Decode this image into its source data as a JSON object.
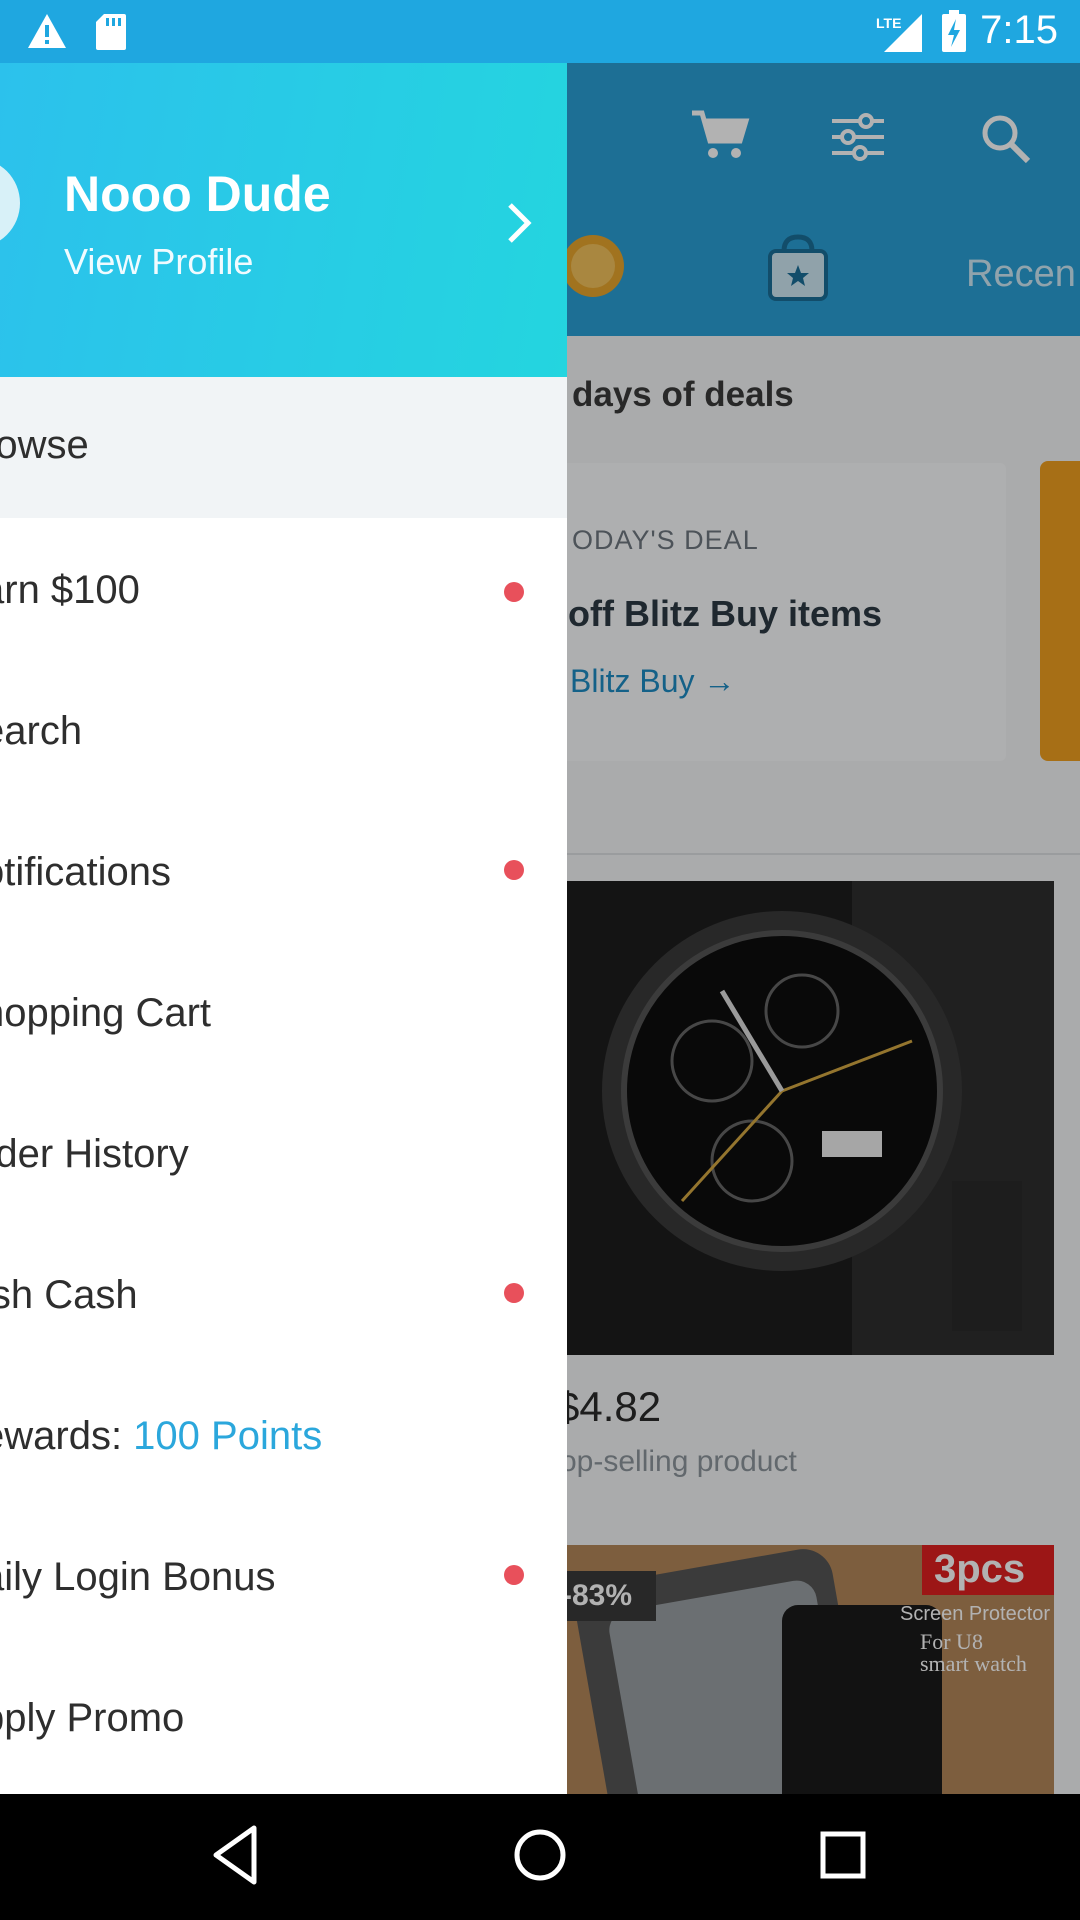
{
  "status_bar": {
    "time": "7:15",
    "left_icons": [
      "warning-icon",
      "sd-card-icon"
    ],
    "right_icons": [
      "lte-signal-icon",
      "battery-charging-icon"
    ],
    "color": "#1fa7e0"
  },
  "background_app": {
    "header_icons": [
      "cart-icon",
      "filter-icon",
      "search-icon"
    ],
    "tab_icons": [
      "coin-icon",
      "bag-icon"
    ],
    "recent_tab_label": "Recen",
    "deals_heading": "days of deals",
    "deal": {
      "eyebrow": "ODAY'S DEAL",
      "title": "off Blitz Buy items",
      "link": "Blitz Buy"
    },
    "product": {
      "price": "$4.82",
      "subtitle": "op-selling product",
      "discount": "-83%",
      "pcs_badge": "3pcs",
      "screen_protector": "Screen Protector",
      "for_line1": "For U8",
      "for_line2": "smart watch"
    }
  },
  "drawer": {
    "profile_name": "Nooo Dude",
    "view_profile": "View Profile",
    "header_gradient": [
      "#2cc1ec",
      "#24d5df"
    ],
    "items": [
      {
        "label": "rowse",
        "dot": false,
        "active": true
      },
      {
        "label": "arn $100",
        "dot": true
      },
      {
        "label": "earch",
        "dot": false
      },
      {
        "label": "otifications",
        "dot": true
      },
      {
        "label": "nopping Cart",
        "dot": false
      },
      {
        "label": "rder History",
        "dot": false
      },
      {
        "label": "ish Cash",
        "dot": true
      },
      {
        "label": "ewards: ",
        "suffix": "100 Points",
        "dot": false
      },
      {
        "label": "aily Login Bonus",
        "dot": true
      },
      {
        "label": "pply Promo",
        "dot": false
      }
    ],
    "dot_color": "#e8505b",
    "accent_color": "#2ba7dc"
  },
  "nav_bar": {
    "buttons": [
      "back-icon",
      "home-icon",
      "recents-icon"
    ]
  }
}
